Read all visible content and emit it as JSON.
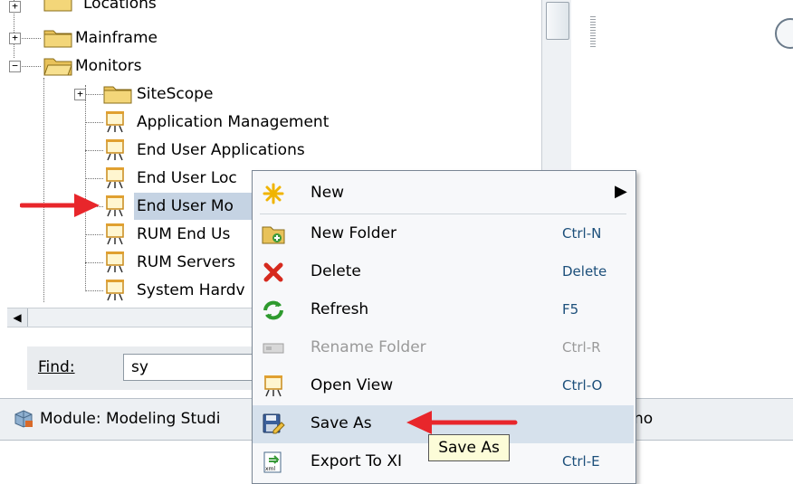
{
  "tree": {
    "items": [
      {
        "label": "Locations",
        "type": "folder",
        "expander": "+"
      },
      {
        "label": "Mainframe",
        "type": "folder",
        "expander": "+"
      },
      {
        "label": "Monitors",
        "type": "folder",
        "expander": "−"
      },
      {
        "label": "SiteScope",
        "type": "folder",
        "expander": "+"
      },
      {
        "label": "Application Management",
        "type": "view"
      },
      {
        "label": "End User Applications",
        "type": "view"
      },
      {
        "label": "End User Loc",
        "type": "view"
      },
      {
        "label": "End User Mo",
        "type": "view",
        "selected": true
      },
      {
        "label": "RUM End Us",
        "type": "view"
      },
      {
        "label": "RUM Servers",
        "type": "view"
      },
      {
        "label": "System Hardv",
        "type": "view"
      }
    ]
  },
  "find": {
    "label": "Find:",
    "value": "sy"
  },
  "status_bar": {
    "module_text": "Module: Modeling Studi",
    "right_text": "no"
  },
  "context_menu": {
    "items": [
      {
        "label": "New",
        "shortcut": "",
        "icon": "star-icon",
        "submenu": true
      },
      {
        "label": "New Folder",
        "shortcut": "Ctrl-N",
        "icon": "new-folder-icon"
      },
      {
        "label": "Delete",
        "shortcut": "Delete",
        "icon": "delete-x-icon"
      },
      {
        "label": "Refresh",
        "shortcut": "F5",
        "icon": "refresh-icon"
      },
      {
        "label": "Rename Folder",
        "shortcut": "Ctrl-R",
        "icon": "rename-icon",
        "disabled": true
      },
      {
        "label": "Open View",
        "shortcut": "Ctrl-O",
        "icon": "view-icon"
      },
      {
        "label": "Save As",
        "shortcut": "",
        "icon": "save-as-icon",
        "hover": true
      },
      {
        "label": "Export To XML",
        "shortcut": "Ctrl-E",
        "icon": "export-xml-icon"
      }
    ],
    "visible_export_label": "Export To XI"
  },
  "tooltip": {
    "text": "Save As"
  },
  "colors": {
    "selection": "#c5d3e3",
    "menu_hover": "#d6e1ec",
    "arrow_red": "#e8262b",
    "tooltip_bg": "#fcfcd8"
  }
}
